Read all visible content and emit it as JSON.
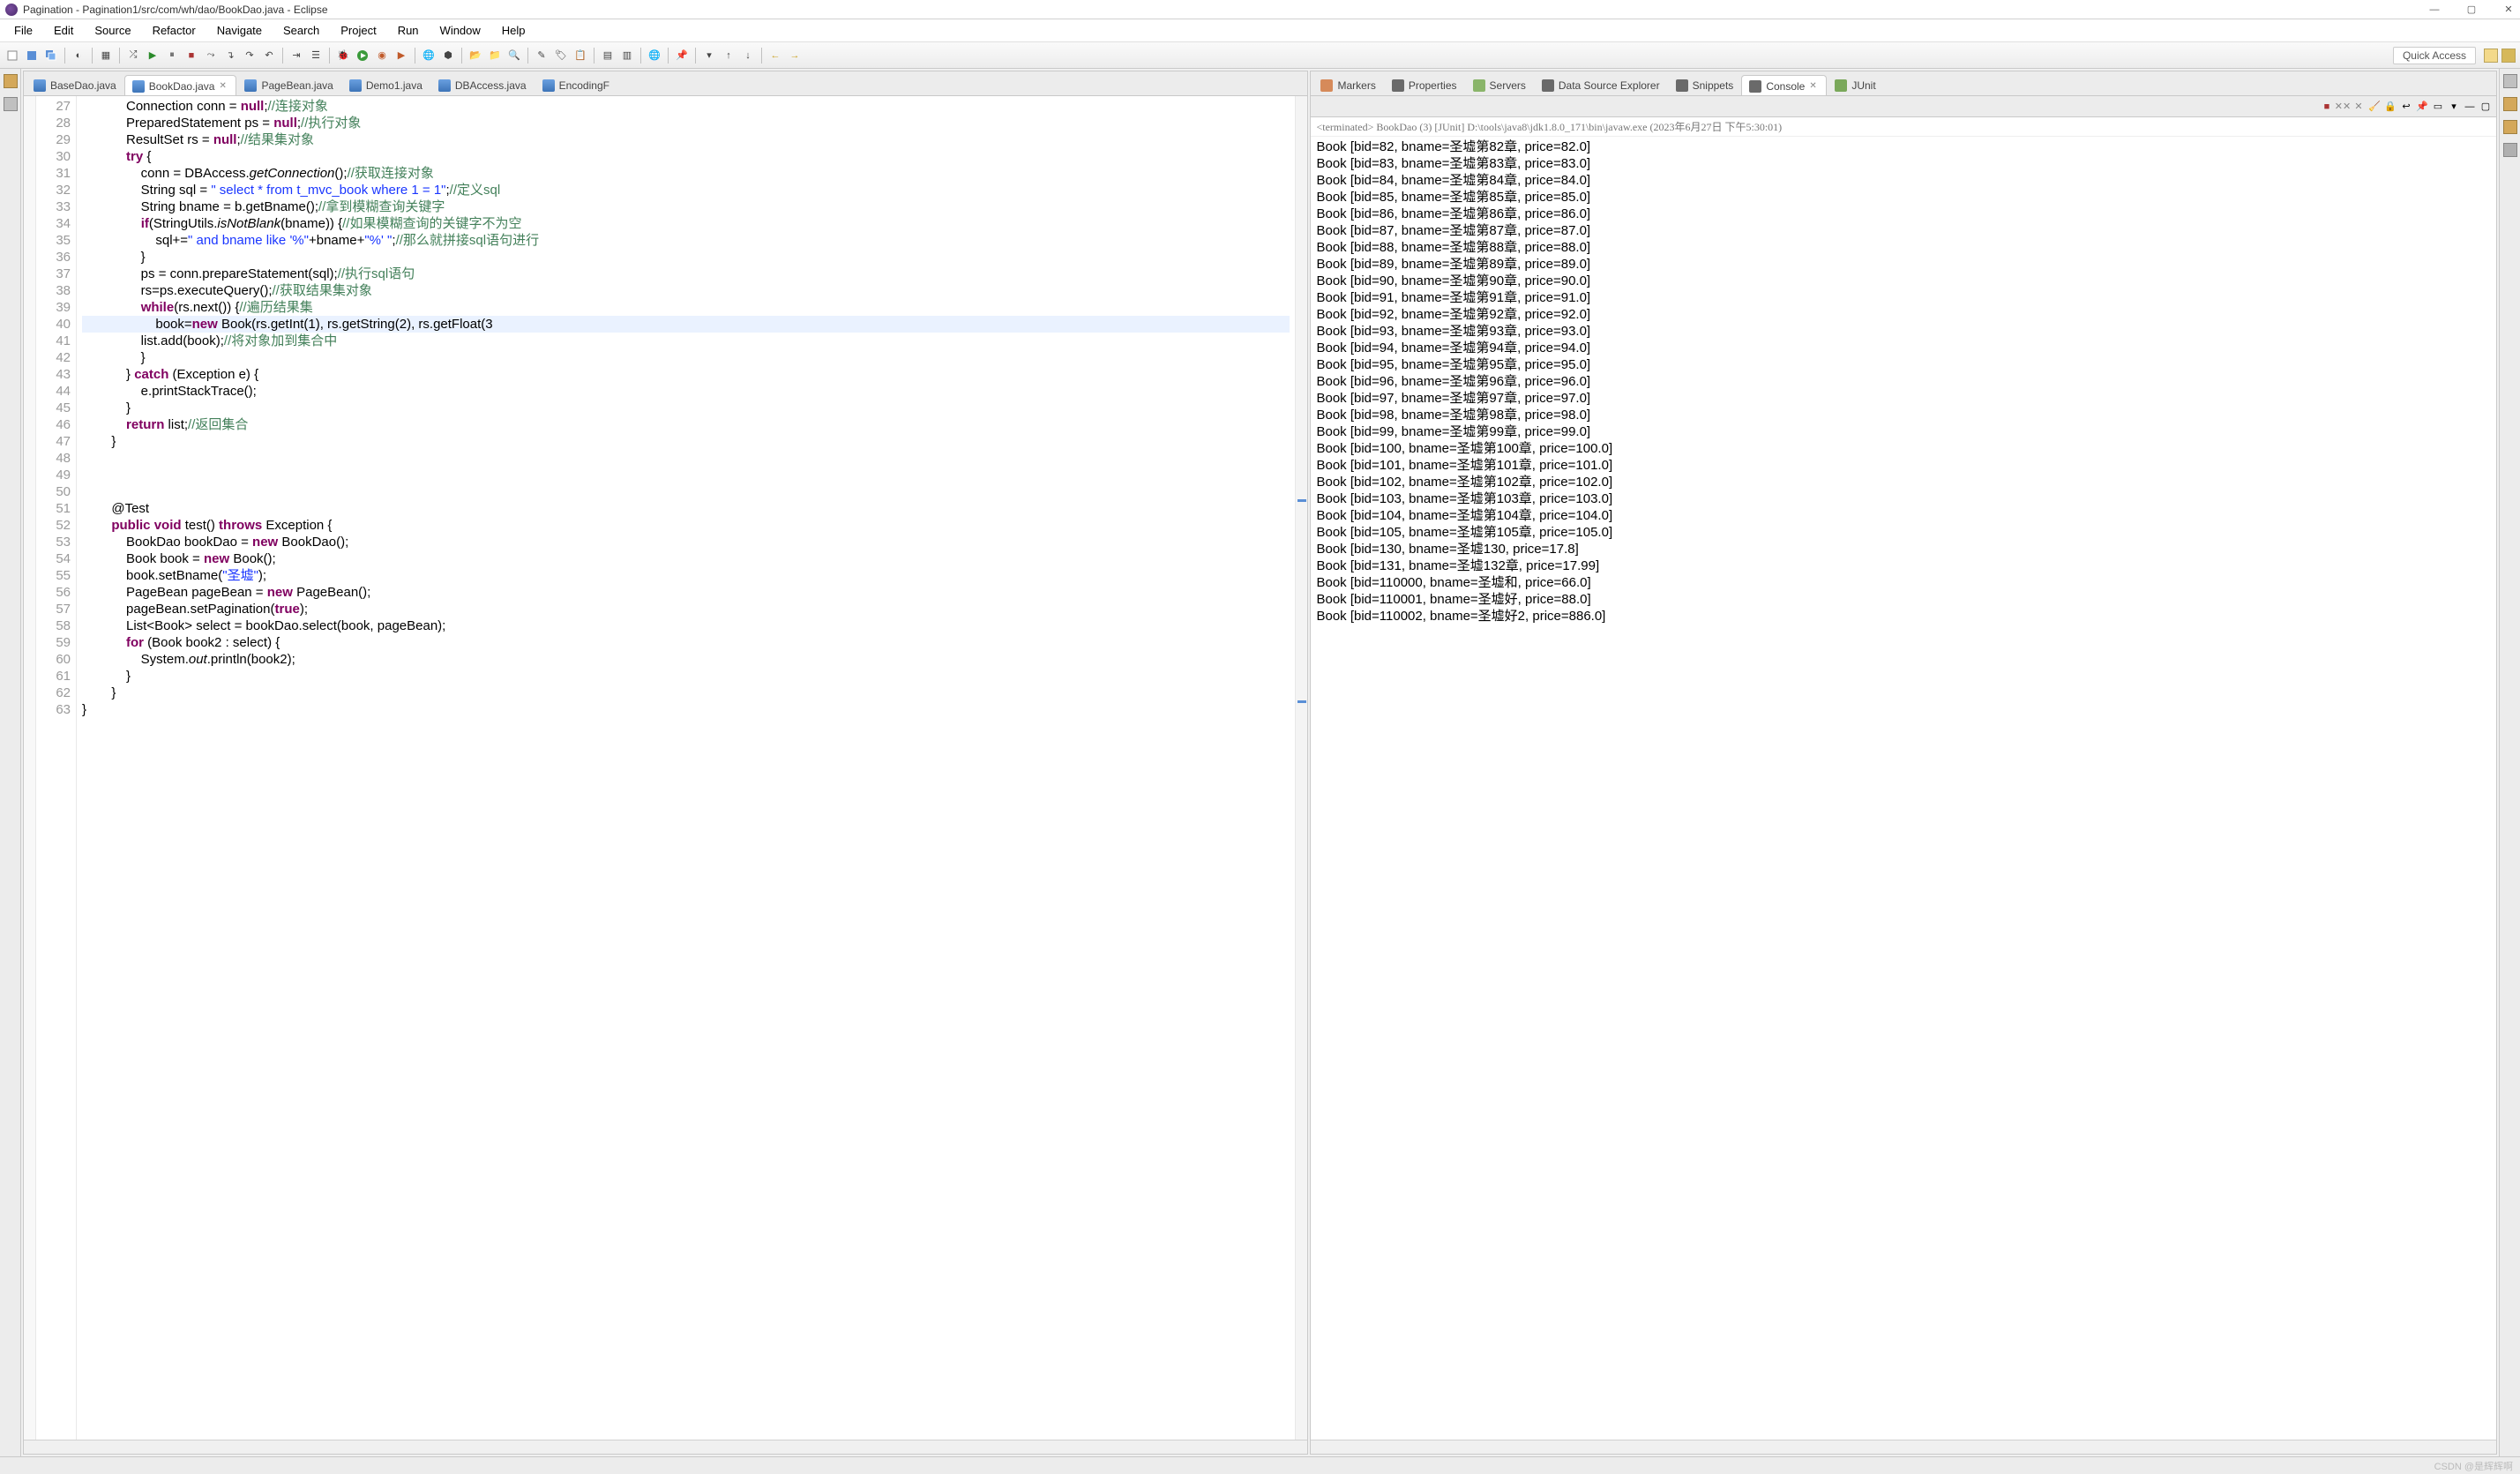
{
  "window": {
    "title": "Pagination - Pagination1/src/com/wh/dao/BookDao.java - Eclipse"
  },
  "menu": [
    "File",
    "Edit",
    "Source",
    "Refactor",
    "Navigate",
    "Search",
    "Project",
    "Run",
    "Window",
    "Help"
  ],
  "quick_access": "Quick Access",
  "editor_tabs": [
    {
      "label": "BaseDao.java",
      "active": false,
      "cls": "j"
    },
    {
      "label": "BookDao.java",
      "active": true,
      "cls": "j"
    },
    {
      "label": "PageBean.java",
      "active": false,
      "cls": "j"
    },
    {
      "label": "Demo1.java",
      "active": false,
      "cls": "j"
    },
    {
      "label": "DBAccess.java",
      "active": false,
      "cls": "j"
    },
    {
      "label": "EncodingF",
      "active": false,
      "cls": "j"
    }
  ],
  "console_tabs": [
    {
      "label": "Markers",
      "cls": "m"
    },
    {
      "label": "Properties",
      "cls": "c"
    },
    {
      "label": "Servers",
      "cls": "s"
    },
    {
      "label": "Data Source Explorer",
      "cls": "c"
    },
    {
      "label": "Snippets",
      "cls": "c"
    },
    {
      "label": "Console",
      "cls": "c",
      "active": true
    },
    {
      "label": "JUnit",
      "cls": "u"
    }
  ],
  "gutter_start": 27,
  "gutter_end": 63,
  "code_lines": [
    "            Connection conn = <kw>null</kw>;<cm>//连接对象</cm>",
    "            PreparedStatement ps = <kw>null</kw>;<cm>//执行对象</cm>",
    "            ResultSet rs = <kw>null</kw>;<cm>//结果集对象</cm>",
    "            <kw>try</kw> {",
    "                conn = DBAccess.<it>getConnection</it>();<cm>//获取连接对象</cm>",
    "                String sql = <st>\" select * from t_mvc_book where 1 = 1\"</st>;<cm>//定义sql</cm>",
    "                String bname = b.getBname();<cm>//拿到模糊查询关键字</cm>",
    "                <kw>if</kw>(StringUtils.<it>isNotBlank</it>(bname)) {<cm>//如果模糊查询的关键字不为空</cm>",
    "                    sql+=<st>\" and bname like '%\"</st>+bname+<st>\"%' \"</st>;<cm>//那么就拼接sql语句进行</cm>",
    "                }",
    "                ps = conn.prepareStatement(sql);<cm>//执行sql语句</cm>",
    "                rs=ps.executeQuery();<cm>//获取结果集对象</cm>",
    "                <kw>while</kw>(rs.next()) {<cm>//遍历结果集</cm>",
    "<hl>                    book=<kw>new</kw> Book(rs.getInt(1), rs.getString(2), rs.getFloat(3</hl>",
    "                list.add(book);<cm>//将对象加到集合中</cm>",
    "                }",
    "            } <kw>catch</kw> (Exception e) {",
    "                e.printStackTrace();",
    "            }",
    "            <kw>return</kw> list;<cm>//返回集合</cm>",
    "        }",
    "",
    "",
    "",
    "        @Test",
    "        <kw>public</kw> <kw>void</kw> test() <kw>throws</kw> Exception {",
    "            BookDao bookDao = <kw>new</kw> BookDao();",
    "            Book book = <kw>new</kw> Book();",
    "            book.setBname(<st>\"圣墟\"</st>);",
    "            PageBean pageBean = <kw>new</kw> PageBean();",
    "            pageBean.setPagination(<kw>true</kw>);",
    "            List&lt;Book&gt; select = bookDao.select(book, pageBean);",
    "            <kw>for</kw> (Book book2 : select) {",
    "                System.<it>out</it>.println(book2);",
    "            }",
    "        }",
    "}"
  ],
  "console_header": "<terminated> BookDao (3) [JUnit] D:\\tools\\java8\\jdk1.8.0_171\\bin\\javaw.exe (2023年6月27日 下午5:30:01)",
  "console_lines": [
    "Book [bid=82, bname=圣墟第82章, price=82.0]",
    "Book [bid=83, bname=圣墟第83章, price=83.0]",
    "Book [bid=84, bname=圣墟第84章, price=84.0]",
    "Book [bid=85, bname=圣墟第85章, price=85.0]",
    "Book [bid=86, bname=圣墟第86章, price=86.0]",
    "Book [bid=87, bname=圣墟第87章, price=87.0]",
    "Book [bid=88, bname=圣墟第88章, price=88.0]",
    "Book [bid=89, bname=圣墟第89章, price=89.0]",
    "Book [bid=90, bname=圣墟第90章, price=90.0]",
    "Book [bid=91, bname=圣墟第91章, price=91.0]",
    "Book [bid=92, bname=圣墟第92章, price=92.0]",
    "Book [bid=93, bname=圣墟第93章, price=93.0]",
    "Book [bid=94, bname=圣墟第94章, price=94.0]",
    "Book [bid=95, bname=圣墟第95章, price=95.0]",
    "Book [bid=96, bname=圣墟第96章, price=96.0]",
    "Book [bid=97, bname=圣墟第97章, price=97.0]",
    "Book [bid=98, bname=圣墟第98章, price=98.0]",
    "Book [bid=99, bname=圣墟第99章, price=99.0]",
    "Book [bid=100, bname=圣墟第100章, price=100.0]",
    "Book [bid=101, bname=圣墟第101章, price=101.0]",
    "Book [bid=102, bname=圣墟第102章, price=102.0]",
    "Book [bid=103, bname=圣墟第103章, price=103.0]",
    "Book [bid=104, bname=圣墟第104章, price=104.0]",
    "Book [bid=105, bname=圣墟第105章, price=105.0]",
    "Book [bid=130, bname=圣墟130, price=17.8]",
    "Book [bid=131, bname=圣墟132章, price=17.99]",
    "Book [bid=110000, bname=圣墟和, price=66.0]",
    "Book [bid=110001, bname=圣墟好, price=88.0]",
    "Book [bid=110002, bname=圣墟好2, price=886.0]"
  ],
  "watermark": "CSDN @是辉辉啊"
}
